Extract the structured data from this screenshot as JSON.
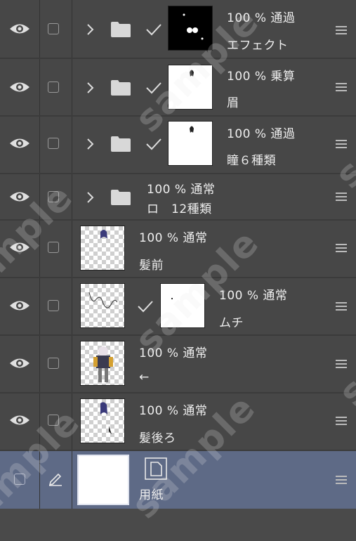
{
  "layers": [
    {
      "opacity": "100 %",
      "blend": "通過",
      "name": "エフェクト",
      "type": "folder",
      "clip": true,
      "thumb": "black"
    },
    {
      "opacity": "100 %",
      "blend": "乗算",
      "name": "眉",
      "type": "folder",
      "clip": true,
      "thumb": "white"
    },
    {
      "opacity": "100 %",
      "blend": "通過",
      "name": "瞳６種類",
      "type": "folder",
      "clip": true,
      "thumb": "white"
    },
    {
      "opacity": "100 %",
      "blend": "通常",
      "name": "ロ　12種類",
      "type": "folder",
      "clip": false,
      "thumb": "none"
    },
    {
      "opacity": "100 %",
      "blend": "通常",
      "name": "髪前",
      "type": "raster",
      "clip": false,
      "thumb": "checker"
    },
    {
      "opacity": "100 %",
      "blend": "通常",
      "name": "ムチ",
      "type": "raster",
      "clip": true,
      "thumb": "checker"
    },
    {
      "opacity": "100 %",
      "blend": "通常",
      "name": "←",
      "type": "raster",
      "clip": false,
      "thumb": "checker"
    },
    {
      "opacity": "100 %",
      "blend": "通常",
      "name": "髪後ろ",
      "type": "raster",
      "clip": false,
      "thumb": "checker"
    },
    {
      "opacity": "",
      "blend": "",
      "name": "用紙",
      "type": "paper",
      "clip": false,
      "thumb": "white"
    }
  ],
  "watermark": "sample",
  "colors": {
    "selected_row": "#5e6a86",
    "row": "#474747",
    "separator": "#333333"
  },
  "icons": {
    "visibility": "eye-icon",
    "lock": "checkbox-icon",
    "expand": "chevron-right-icon",
    "folder": "folder-icon",
    "clipping": "checkmark-icon",
    "paper": "pen-icon",
    "handle": "drag-handle-icon",
    "layer_property": "paper-layer-icon"
  }
}
